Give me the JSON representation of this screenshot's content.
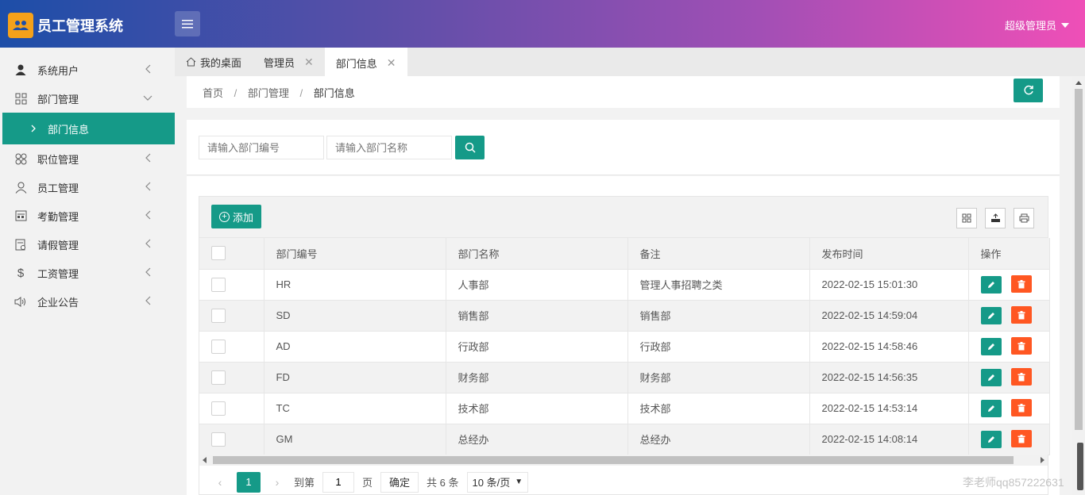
{
  "app": {
    "title": "员工管理系统"
  },
  "header": {
    "user": "超级管理员"
  },
  "sidebar": {
    "items": [
      {
        "label": "系统用户",
        "icon": "user-icon"
      },
      {
        "label": "部门管理",
        "icon": "grid-icon"
      },
      {
        "label": "职位管理",
        "icon": "apps-icon"
      },
      {
        "label": "员工管理",
        "icon": "person-icon"
      },
      {
        "label": "考勤管理",
        "icon": "calendar-icon"
      },
      {
        "label": "请假管理",
        "icon": "form-icon"
      },
      {
        "label": "工资管理",
        "icon": "dollar-icon"
      },
      {
        "label": "企业公告",
        "icon": "speaker-icon"
      }
    ],
    "sub_active": "部门信息"
  },
  "tabs": [
    {
      "label": "我的桌面"
    },
    {
      "label": "管理员"
    },
    {
      "label": "部门信息"
    }
  ],
  "breadcrumb": {
    "home": "首页",
    "parent": "部门管理",
    "current": "部门信息"
  },
  "search": {
    "code_placeholder": "请输入部门编号",
    "name_placeholder": "请输入部门名称"
  },
  "toolbar": {
    "add_label": "添加"
  },
  "table": {
    "headers": [
      "部门编号",
      "部门名称",
      "备注",
      "发布时间",
      "操作"
    ],
    "rows": [
      {
        "code": "HR",
        "name": "人事部",
        "remark": "管理人事招聘之类",
        "time": "2022-02-15 15:01:30"
      },
      {
        "code": "SD",
        "name": "销售部",
        "remark": "销售部",
        "time": "2022-02-15 14:59:04"
      },
      {
        "code": "AD",
        "name": "行政部",
        "remark": "行政部",
        "time": "2022-02-15 14:58:46"
      },
      {
        "code": "FD",
        "name": "财务部",
        "remark": "财务部",
        "time": "2022-02-15 14:56:35"
      },
      {
        "code": "TC",
        "name": "技术部",
        "remark": "技术部",
        "time": "2022-02-15 14:53:14"
      },
      {
        "code": "GM",
        "name": "总经办",
        "remark": "总经办",
        "time": "2022-02-15 14:08:14"
      }
    ]
  },
  "pager": {
    "current_page": "1",
    "goto_label": "到第",
    "goto_value": "1",
    "page_unit": "页",
    "confirm": "确定",
    "total": "共 6 条",
    "page_size": "10 条/页"
  },
  "watermark": "李老师qq857222631",
  "colors": {
    "primary": "#159a88",
    "danger": "#ff5722",
    "logo": "#f5a11a"
  }
}
